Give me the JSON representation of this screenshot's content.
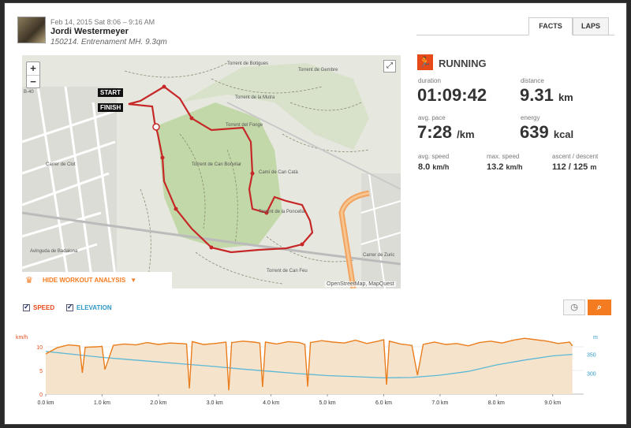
{
  "header": {
    "date": "Feb 14, 2015 Sat 8:06 – 9:16 AM",
    "athlete": "Jordi Westermeyer",
    "workout_name": "150214. Entrenament MH. 9.3qm"
  },
  "tabs": [
    {
      "label": "FACTS"
    },
    {
      "label": "LAPS"
    }
  ],
  "map": {
    "zoom_in": "+",
    "zoom_out": "−",
    "start_label": "START",
    "finish_label": "FINISH",
    "attribution": "OpenStreetMap, MapQuest",
    "hide_label": "HIDE WORKOUT ANALYSIS",
    "route_color": "#c62828",
    "street_labels": [
      "Torrent de Botigues",
      "Torrent de Gembre",
      "Torrent de la Mutra",
      "Torrent del Fonge",
      "Torrent de Can Bonvilar",
      "Torrent de la Poncella",
      "Torrent de Can Feu",
      "Camí de Can Catà",
      "Carrer de Zuric",
      "Carrer de Clot",
      "Avinguda de Badalona",
      "B-40"
    ]
  },
  "stats": {
    "activity": "RUNNING",
    "duration": {
      "label": "duration",
      "value": "01:09:42"
    },
    "distance": {
      "label": "distance",
      "value": "9.31",
      "unit": "km"
    },
    "avg_pace": {
      "label": "avg. pace",
      "value": "7:28",
      "unit": "/km"
    },
    "energy": {
      "label": "energy",
      "value": "639",
      "unit": "kcal"
    },
    "avg_speed": {
      "label": "avg. speed",
      "value": "8.0",
      "unit": "km/h"
    },
    "max_speed": {
      "label": "max. speed",
      "value": "13.2",
      "unit": "km/h"
    },
    "ascent": {
      "label": "ascent / descent",
      "value": "112 / 125",
      "unit": "m"
    }
  },
  "legend": {
    "speed": "SPEED",
    "elevation": "ELEVATION"
  },
  "colors": {
    "accent": "#f47b20",
    "speed": "#ea7d1c",
    "elevation": "#5bb8d6",
    "speed_fill": "#f6e3cc",
    "brand_red": "#e64a19"
  },
  "chart_data": {
    "type": "line",
    "xlabel": "",
    "x_unit": "km",
    "x_ticks": [
      "0.0 km",
      "1.0 km",
      "2.0 km",
      "3.0 km",
      "4.0 km",
      "5.0 km",
      "6.0 km",
      "7.0 km",
      "8.0 km",
      "9.0 km"
    ],
    "y_left_label": "km/h",
    "y_left_ticks": [
      "10",
      "5",
      "0"
    ],
    "y_left_lim": [
      0,
      12
    ],
    "y_right_label": "m",
    "y_right_ticks": [
      "350",
      "300"
    ],
    "y_right_lim": [
      245,
      395
    ],
    "x_lim": [
      0,
      9.55
    ],
    "series": [
      {
        "name": "SPEED",
        "x": [
          0.0,
          0.2,
          0.4,
          0.6,
          0.65,
          0.7,
          0.9,
          1.0,
          1.05,
          1.2,
          1.4,
          1.6,
          1.8,
          2.0,
          2.2,
          2.4,
          2.5,
          2.55,
          2.6,
          2.8,
          3.0,
          3.2,
          3.25,
          3.3,
          3.5,
          3.7,
          3.8,
          3.85,
          3.9,
          4.1,
          4.3,
          4.5,
          4.6,
          4.65,
          4.7,
          4.9,
          5.1,
          5.3,
          5.5,
          5.7,
          5.9,
          6.0,
          6.05,
          6.1,
          6.3,
          6.5,
          6.6,
          6.7,
          6.9,
          7.1,
          7.3,
          7.5,
          7.7,
          7.9,
          8.1,
          8.3,
          8.5,
          8.7,
          8.9,
          9.1,
          9.3,
          9.35
        ],
        "values": [
          8.5,
          9.8,
          10.4,
          10.2,
          4.5,
          9.9,
          10.0,
          10.1,
          5.2,
          10.3,
          10.6,
          10.4,
          10.9,
          10.5,
          10.8,
          10.7,
          10.6,
          1.2,
          11.1,
          10.5,
          10.7,
          11.0,
          0.8,
          10.9,
          11.2,
          11.0,
          10.8,
          1.5,
          11.0,
          10.6,
          11.1,
          10.9,
          10.5,
          1.6,
          10.9,
          11.3,
          11.0,
          10.8,
          11.4,
          10.7,
          11.2,
          11.5,
          2.0,
          11.2,
          10.6,
          10.3,
          4.0,
          10.5,
          11.0,
          10.5,
          10.7,
          10.2,
          10.9,
          11.2,
          10.8,
          11.4,
          11.8,
          11.5,
          11.2,
          10.7,
          11.0,
          10.2
        ]
      },
      {
        "name": "ELEVATION",
        "x": [
          0.0,
          0.5,
          1.0,
          1.5,
          2.0,
          2.5,
          3.0,
          3.5,
          4.0,
          4.5,
          5.0,
          5.5,
          6.0,
          6.5,
          7.0,
          7.5,
          8.0,
          8.5,
          9.0,
          9.35
        ],
        "values": [
          358,
          350,
          342,
          336,
          330,
          324,
          318,
          311,
          305,
          299,
          294,
          291,
          288,
          289,
          295,
          305,
          322,
          335,
          346,
          350
        ]
      }
    ]
  }
}
